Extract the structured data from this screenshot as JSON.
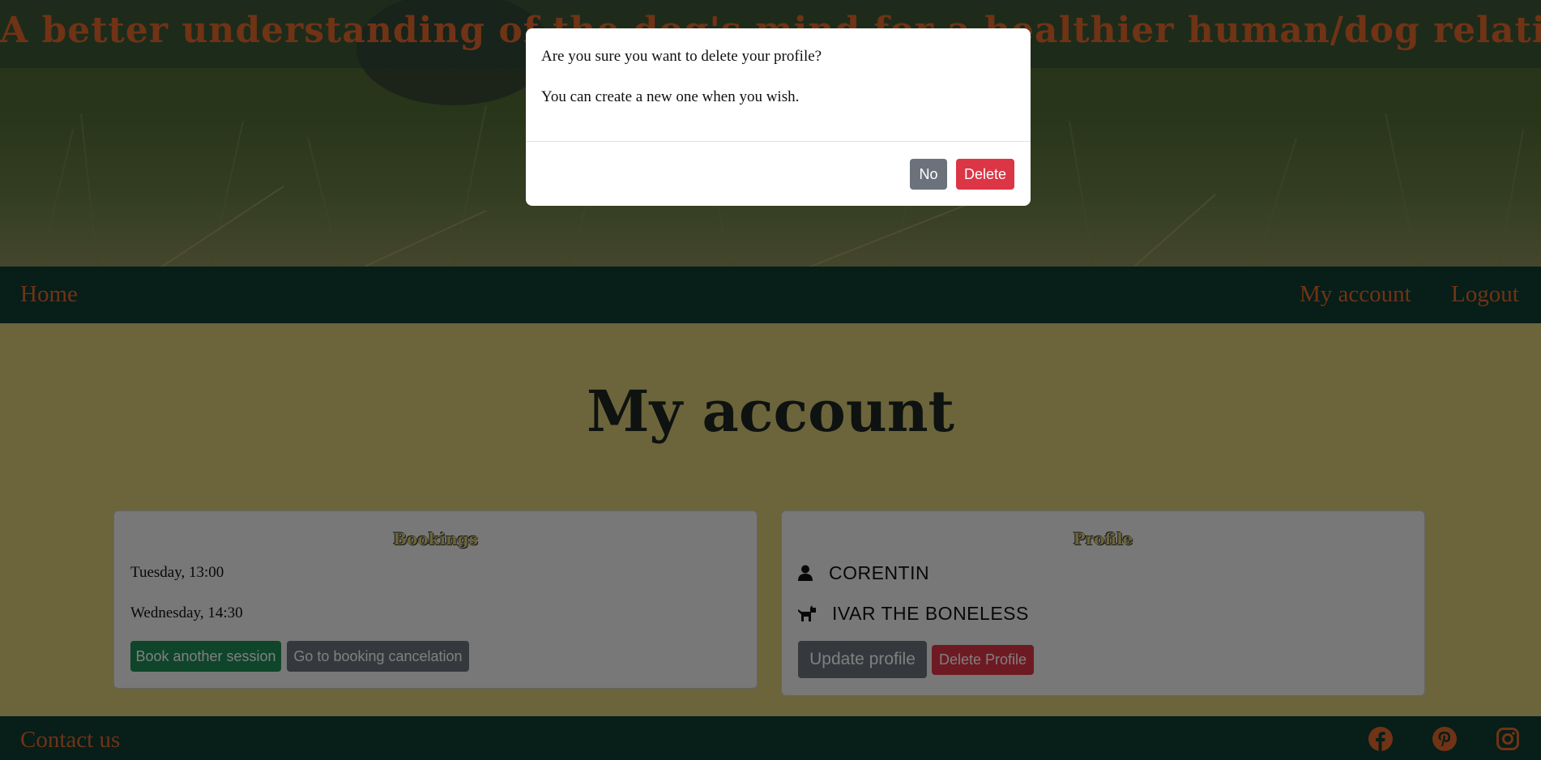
{
  "hero": {
    "tagline": "A better understanding of the dog's mind for a healthier human/dog relationship"
  },
  "nav": {
    "home": "Home",
    "my_account": "My account",
    "logout": "Logout"
  },
  "main": {
    "title": "My account",
    "bookings": {
      "title": "Bookings",
      "items": [
        "Tuesday, 13:00",
        "Wednesday, 14:30"
      ],
      "book_button": "Book another session",
      "cancel_button": "Go to booking cancelation"
    },
    "profile": {
      "title": "Profile",
      "user_icon": "user-icon",
      "user_name": "CORENTIN",
      "dog_icon": "dog-icon",
      "dog_name": "IVAR THE BONELESS",
      "update_button": "Update profile",
      "delete_button": "Delete Profile"
    }
  },
  "footer": {
    "contact": "Contact us",
    "social_icons": [
      "facebook-icon",
      "pinterest-icon",
      "instagram-icon"
    ]
  },
  "modal": {
    "question": "Are you sure you want to delete your profile?",
    "note": "You can create a new one when you wish.",
    "no_button": "No",
    "delete_button": "Delete"
  },
  "colors": {
    "accent_orange": "#e0662a",
    "nav_green": "#0f3d33",
    "page_yellow": "#d9ca76",
    "danger_red": "#dc3545",
    "success_green": "#1e8a55",
    "secondary_grey": "#6b727b"
  }
}
